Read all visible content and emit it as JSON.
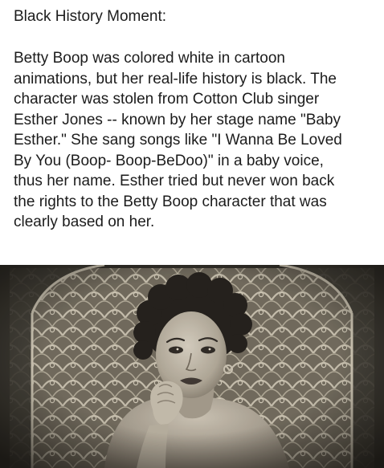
{
  "post": {
    "heading": "Black History Moment:",
    "body_lines": [
      "Betty Boop was colored white in cartoon",
      "animations, but her real-life history is black. The",
      "character was stolen from Cotton Club singer",
      "Esther Jones -- known by her stage name \"Baby",
      "Esther.\" She sang songs like \"I Wanna Be Loved",
      "By You (Boop- Boop-BeDoo)\" in a baby voice,",
      "thus her name. Esther tried but never won back",
      "the rights to the Betty Boop character that was",
      "clearly based on her."
    ]
  },
  "photo": {
    "subject": "sepia portrait photograph of a woman with short curled hair resting her chin on her hand",
    "tone": "sepia"
  }
}
